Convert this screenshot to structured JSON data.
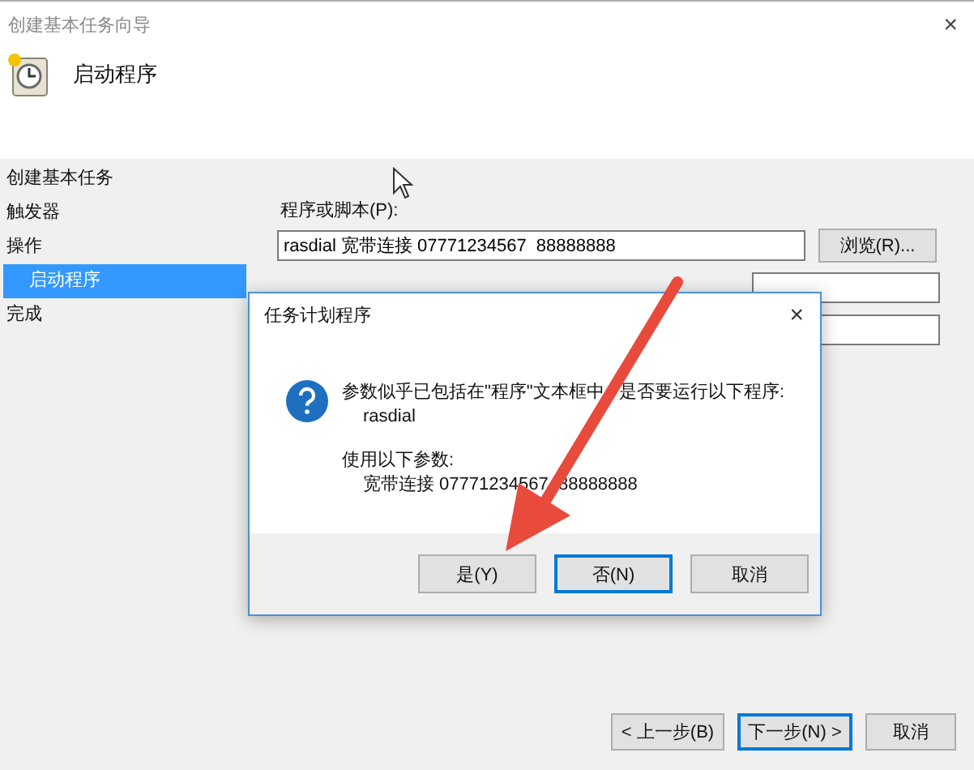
{
  "window": {
    "title": "创建基本任务向导",
    "close": "×"
  },
  "header": {
    "title": "启动程序"
  },
  "sidebar": {
    "items": [
      {
        "label": "创建基本任务",
        "selected": false
      },
      {
        "label": "触发器",
        "selected": false
      },
      {
        "label": "操作",
        "selected": false,
        "children": [
          {
            "label": "启动程序",
            "selected": true
          }
        ]
      },
      {
        "label": "完成",
        "selected": false
      }
    ]
  },
  "form": {
    "program_label": "程序或脚本(P):",
    "program_value": "rasdial 宽带连接 07771234567  88888888",
    "browse_button": "浏览(R)..."
  },
  "dialog": {
    "title": "任务计划程序",
    "close": "×",
    "message": "参数似乎已包括在\"程序\"文本框中   是否要运行以下程序:",
    "program": "rasdial",
    "args_label": "使用以下参数:",
    "args": "宽带连接 07771234567  88888888",
    "buttons": [
      {
        "label": "是(Y)",
        "focused": false
      },
      {
        "label": "否(N)",
        "focused": true
      },
      {
        "label": "取消",
        "focused": false
      }
    ]
  },
  "footer": {
    "buttons": [
      {
        "label": "< 上一步(B)",
        "focused": false
      },
      {
        "label": "下一步(N) >",
        "focused": true
      },
      {
        "label": "取消",
        "focused": false
      }
    ]
  }
}
